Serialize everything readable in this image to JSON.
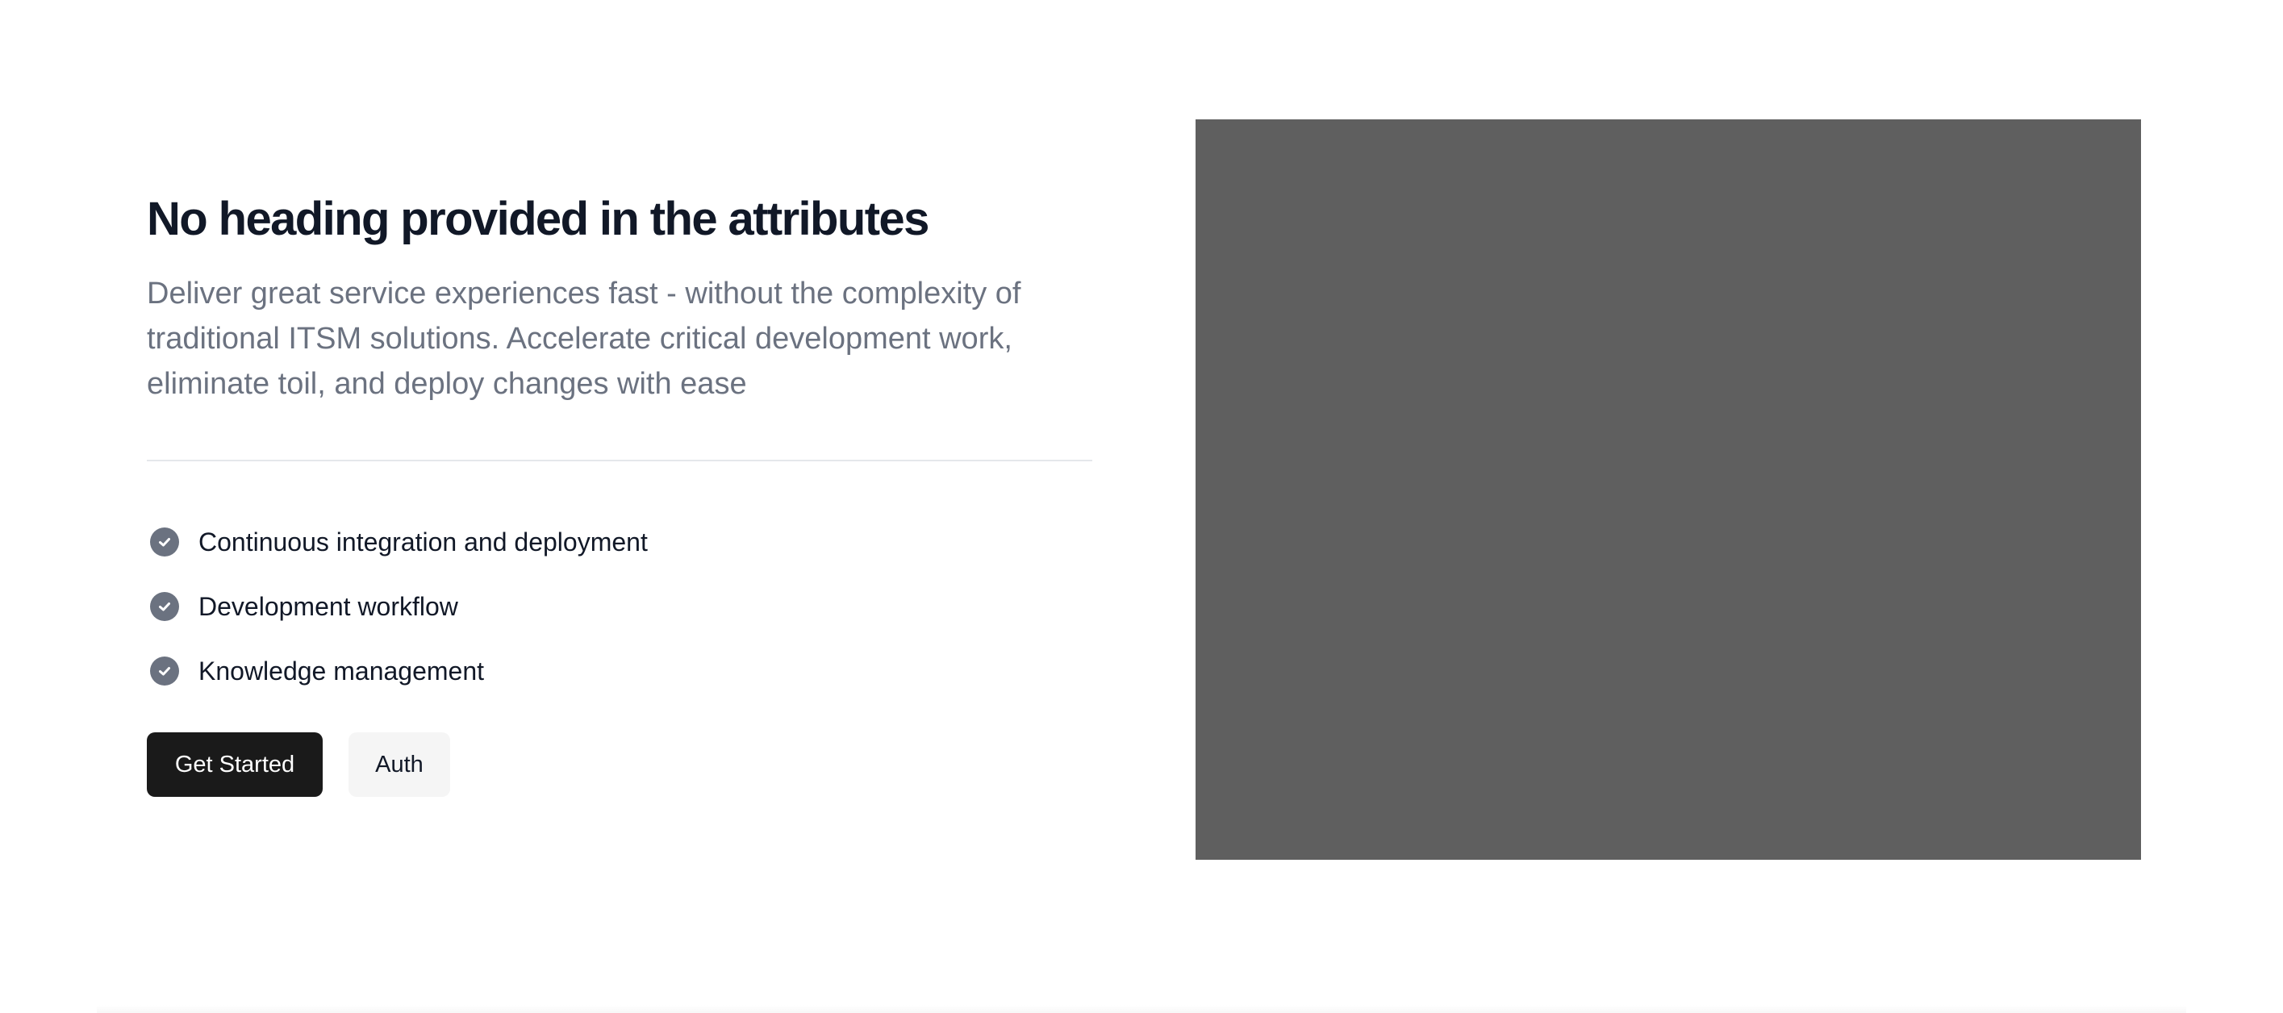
{
  "hero": {
    "heading": "No heading provided in the attributes",
    "subtitle": "Deliver great service experiences fast - without the complexity of traditional ITSM solutions. Accelerate critical development work, eliminate toil, and deploy changes with ease",
    "features": [
      {
        "label": "Continuous integration and deployment",
        "icon": "check-circle-icon"
      },
      {
        "label": "Development workflow",
        "icon": "check-circle-icon"
      },
      {
        "label": "Knowledge management",
        "icon": "check-circle-icon"
      }
    ],
    "primary_button_label": "Get Started",
    "secondary_button_label": "Auth"
  },
  "colors": {
    "heading": "#111827",
    "subtitle": "#6b7280",
    "primary_button": "#1a1a1a",
    "secondary_button": "#f5f5f5",
    "media_placeholder": "#5f5f5f"
  }
}
